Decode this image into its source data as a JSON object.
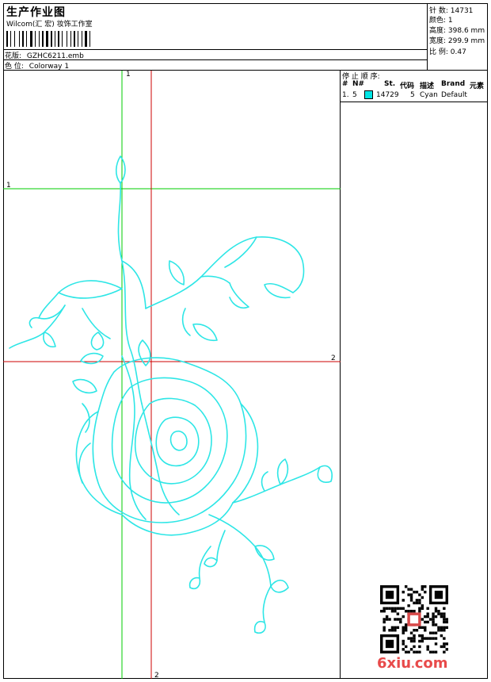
{
  "header": {
    "title": "生产作业图",
    "company": "Wilcom(汇 宏) 妆饰工作室",
    "design_label": "花版:",
    "design_value": "GZHC6211.emb",
    "colorway_label": "色 位:",
    "colorway_value": "Colorway 1"
  },
  "stats": {
    "stitches_label": "针 数:",
    "stitches_value": "14731",
    "colors_label": "颜色:",
    "colors_value": "1",
    "height_label": "高度:",
    "height_value": "398.6 mm",
    "width_label": "宽度:",
    "width_value": "299.9 mm",
    "scale_label": "比 例:",
    "scale_value": "0.47"
  },
  "stop_sequence": {
    "title": "停 止 顺 序:",
    "headers": [
      "#",
      "N#",
      "St.",
      "代码",
      "描述",
      "Brand",
      "元素"
    ],
    "rows": [
      {
        "num": "1.",
        "needle": "5",
        "color": "#00e5e5",
        "stitches": "14729",
        "code": "5",
        "description": "Cyan",
        "brand": "Default"
      }
    ]
  },
  "axes": {
    "v1_label": "1",
    "h1_label": "1",
    "h2_label": "2",
    "v2_label": "2",
    "green": "#00cc00",
    "red": "#cc0000"
  },
  "embroidery_color": "#2ee6e6",
  "watermark": {
    "text_left": "6xiu",
    "dot": ".",
    "text_right": "com"
  }
}
